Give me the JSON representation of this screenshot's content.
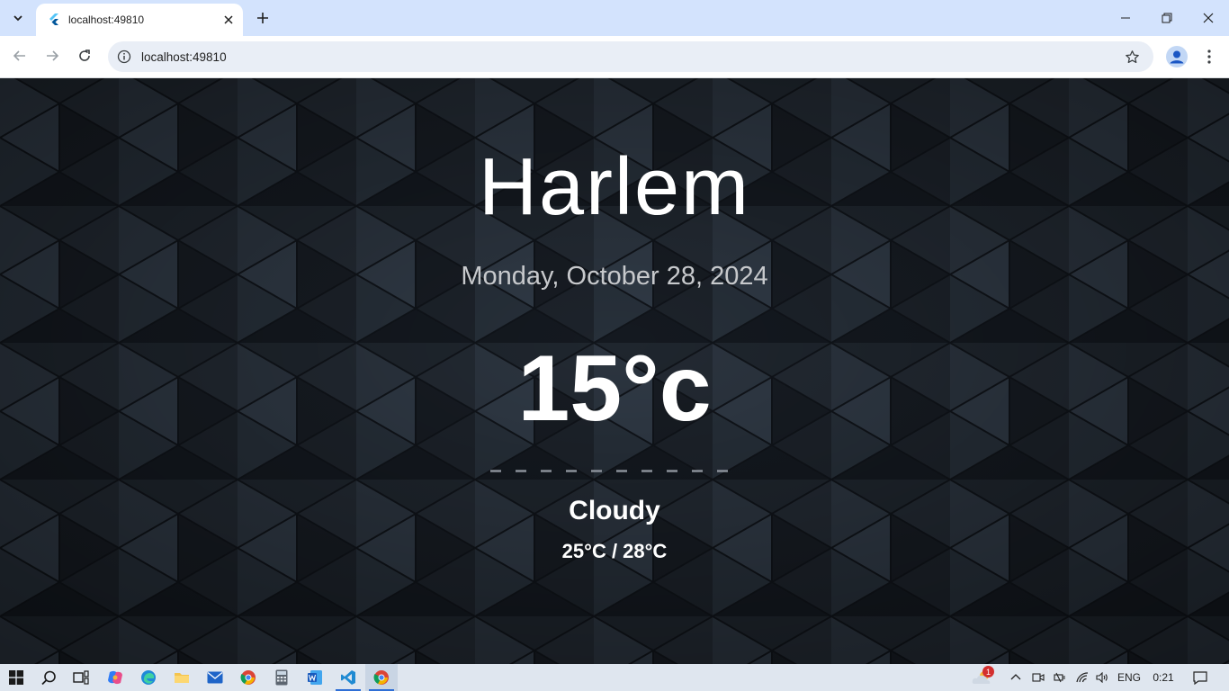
{
  "browser": {
    "tab_title": "localhost:49810",
    "url": "localhost:49810"
  },
  "weather": {
    "city": "Harlem",
    "date": "Monday, October 28, 2024",
    "temperature": "15°c",
    "divider": "----------",
    "condition": "Cloudy",
    "range": "25°C / 28°C"
  },
  "taskbar": {
    "weather_badge": "1",
    "language": "ENG",
    "clock": "0:21"
  },
  "colors": {
    "tab_strip": "#d3e3fd",
    "page_background": "#1e252e",
    "date_text": "#c7c9cc"
  }
}
